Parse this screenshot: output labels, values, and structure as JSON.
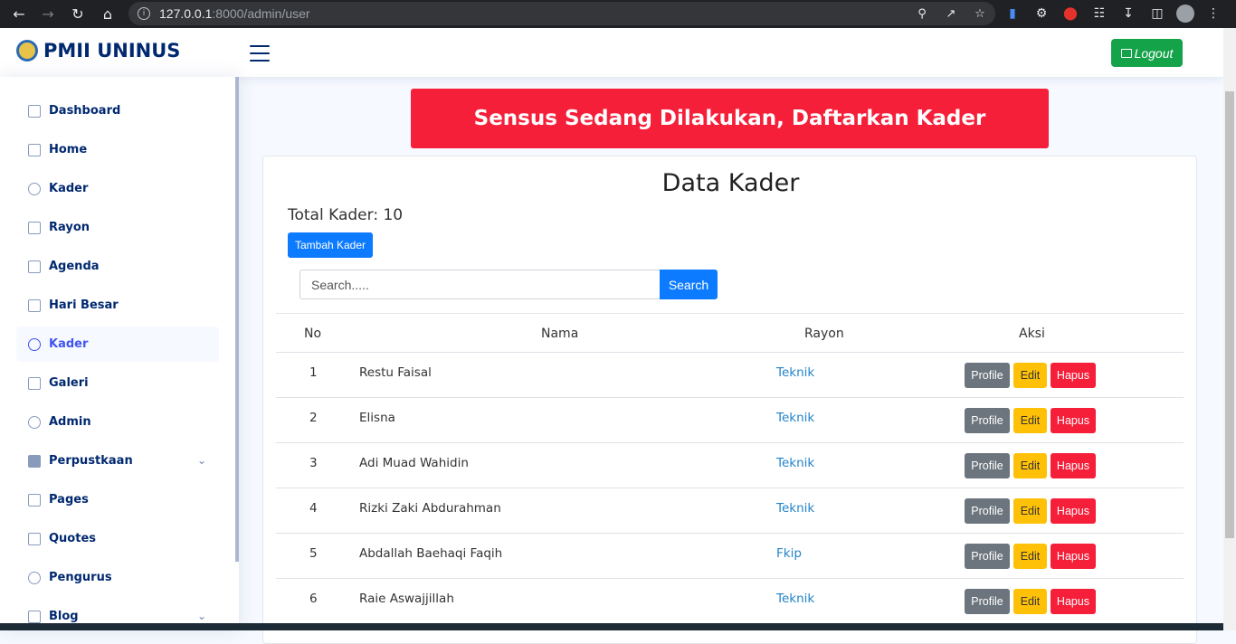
{
  "browser": {
    "url_host": "127.0.0.1",
    "url_path": ":8000/admin/user"
  },
  "header": {
    "brand": "PMII UNINUS",
    "logout_label": "Logout"
  },
  "sidebar": {
    "items": [
      {
        "label": "Dashboard",
        "icon": "grid-icon"
      },
      {
        "label": "Home",
        "icon": "house-icon"
      },
      {
        "label": "Kader",
        "icon": "person-icon"
      },
      {
        "label": "Rayon",
        "icon": "layers-icon"
      },
      {
        "label": "Agenda",
        "icon": "calendar-icon"
      },
      {
        "label": "Hari Besar",
        "icon": "bookmark-icon"
      },
      {
        "label": "Kader",
        "icon": "people-icon",
        "active": true
      },
      {
        "label": "Galeri",
        "icon": "image-icon"
      },
      {
        "label": "Admin",
        "icon": "people-icon"
      },
      {
        "label": "Perpustkaan",
        "icon": "book-icon",
        "has_submenu": true
      },
      {
        "label": "Pages",
        "icon": "pages-icon"
      },
      {
        "label": "Quotes",
        "icon": "chat-icon"
      },
      {
        "label": "Pengurus",
        "icon": "person-lines-icon"
      },
      {
        "label": "Blog",
        "icon": "journal-icon",
        "has_submenu": true
      }
    ]
  },
  "banner": {
    "text": "Sensus Sedang Dilakukan, Daftarkan Kader"
  },
  "main": {
    "title": "Data Kader",
    "total_label": "Total Kader: 10",
    "add_button": "Tambah Kader",
    "search_placeholder": "Search.....",
    "search_button": "Search",
    "columns": [
      "No",
      "Nama",
      "Rayon",
      "Aksi"
    ],
    "rows": [
      {
        "no": "1",
        "nama": "Restu Faisal",
        "rayon": "Teknik"
      },
      {
        "no": "2",
        "nama": "Elisna",
        "rayon": "Teknik"
      },
      {
        "no": "3",
        "nama": "Adi Muad Wahidin",
        "rayon": "Teknik"
      },
      {
        "no": "4",
        "nama": "Rizki Zaki Abdurahman",
        "rayon": "Teknik"
      },
      {
        "no": "5",
        "nama": "Abdallah Baehaqi Faqih",
        "rayon": "Fkip"
      },
      {
        "no": "6",
        "nama": "Raie Aswajjillah",
        "rayon": "Teknik"
      }
    ],
    "action_labels": {
      "profile": "Profile",
      "edit": "Edit",
      "hapus": "Hapus"
    }
  },
  "colors": {
    "brand_navy": "#012970",
    "accent_blue": "#4154f1",
    "danger_red": "#f51f3a",
    "logout_green": "#15a34a",
    "primary_blue": "#0d7bff",
    "warning_yellow": "#ffc107",
    "secondary_gray": "#6c757d"
  }
}
